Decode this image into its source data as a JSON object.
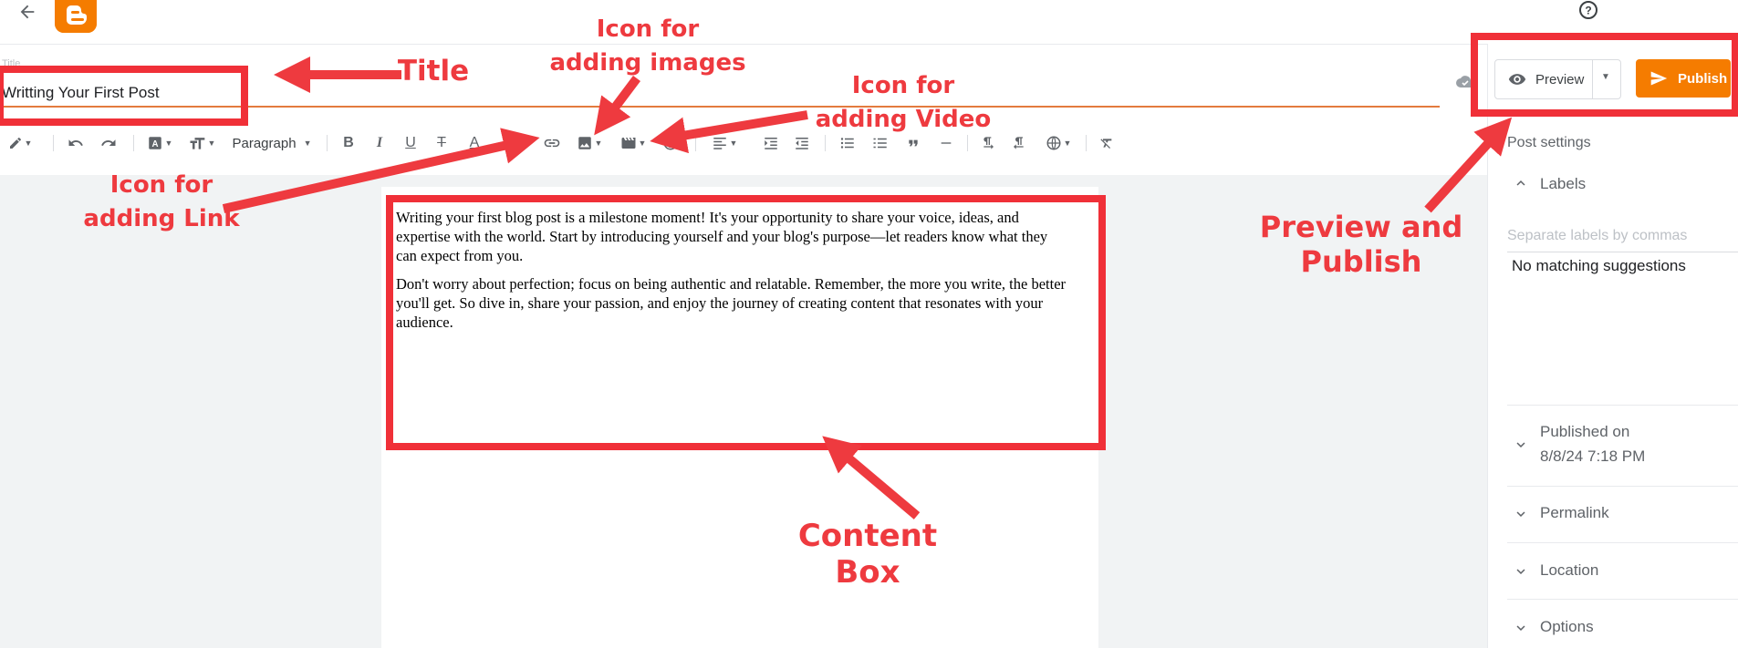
{
  "top_bar": {
    "back_icon": "arrow-left-icon",
    "logo": "blogger-logo",
    "help_icon": "help-circle-icon"
  },
  "title": {
    "label": "Title",
    "value": "Writting Your First Post"
  },
  "toolbar": {
    "paragraph_label": "Paragraph"
  },
  "editor": {
    "paragraphs": [
      "Writing your first blog post is a milestone moment! It's your opportunity to share your voice, ideas, and expertise with the world. Start by introducing yourself and your blog's purpose—let readers know what they can expect from you.",
      "Don't worry about perfection; focus on being authentic and relatable. Remember, the more you write, the better you'll get. So dive in, share your passion, and enjoy the journey of creating content that resonates with your audience."
    ]
  },
  "actions": {
    "preview_label": "Preview",
    "publish_label": "Publish"
  },
  "settings": {
    "heading": "Post settings",
    "labels": {
      "title": "Labels",
      "placeholder": "Separate labels by commas",
      "suggestions": "No matching suggestions"
    },
    "published": {
      "title": "Published on",
      "value": "8/8/24 7:18 PM"
    },
    "permalink": "Permalink",
    "location": "Location",
    "options": "Options"
  },
  "annotations": {
    "title": "Title",
    "images": "Icon for adding images",
    "video": "Icon for adding Video",
    "link": "Icon for adding Link",
    "preview_publish": "Preview and Publish",
    "content_box": "Content Box",
    "color": "#ee3a3f"
  }
}
